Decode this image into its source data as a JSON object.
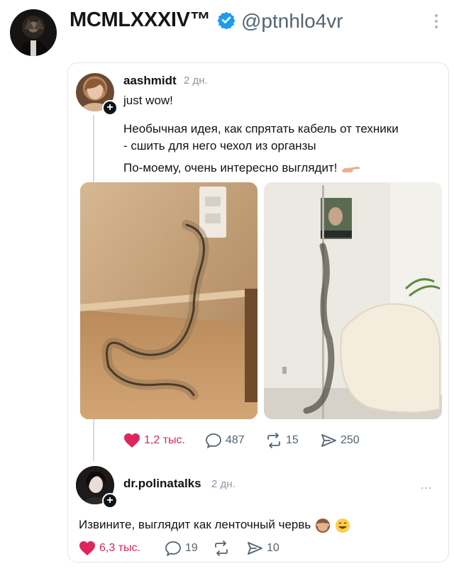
{
  "outer_post": {
    "display_name": "MCMLXXXIV™",
    "handle": "@ptnhlo4vr",
    "verified_color": "#1d9bf0"
  },
  "quoted_post": {
    "username": "aashmidt",
    "time": "2 дн.",
    "lines": [
      "just wow!",
      "Необычная идея, как спрятать кабель от техники",
      "- сшить для него чехол из органзы",
      "По-моему, очень интересно выглядит!"
    ],
    "likes": "1,2 тыс.",
    "comments": "487",
    "reposts": "15",
    "shares": "250"
  },
  "reply": {
    "username": "dr.polinatalks",
    "time": "2 дн.",
    "more": "...",
    "text": "Извините, выглядит как ленточный червь",
    "likes": "6,3 тыс.",
    "comments": "19",
    "shares": "10"
  },
  "colors": {
    "like": "#e0245e",
    "muted": "#536471",
    "verified": "#1d9bf0"
  },
  "icons": [
    "verified-badge-icon",
    "heart-icon",
    "comment-icon",
    "repost-icon",
    "share-icon",
    "see-no-evil-monkey-emoji",
    "grinning-emoji"
  ]
}
